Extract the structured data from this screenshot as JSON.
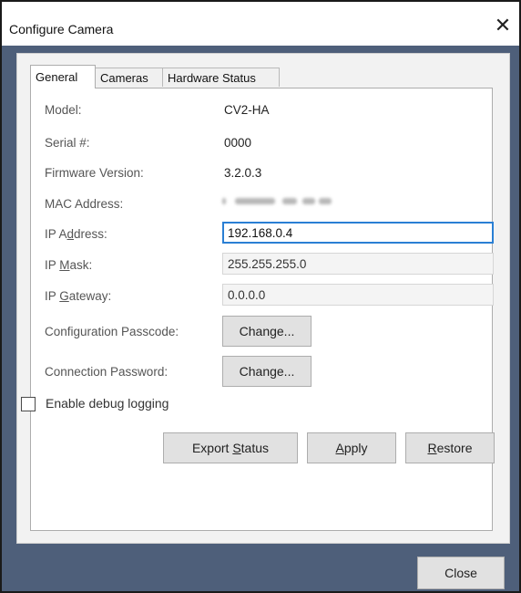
{
  "window": {
    "title": "Configure Camera",
    "close_glyph": "✕"
  },
  "tabs": [
    {
      "label": "General",
      "active": true
    },
    {
      "label": "Cameras",
      "active": false
    },
    {
      "label": "Hardware Status",
      "active": false
    }
  ],
  "general": {
    "model": {
      "label": "Model:",
      "value": "CV2-HA"
    },
    "serial": {
      "label": "Serial #:",
      "value": "0000"
    },
    "firmware": {
      "label": "Firmware Version:",
      "value": "3.2.0.3"
    },
    "mac": {
      "label": "MAC Address:",
      "value_blurred": true
    },
    "ip_address": {
      "label_pre": "IP A",
      "label_ul": "d",
      "label_post": "dress:",
      "value": "192.168.0.4"
    },
    "ip_mask": {
      "label_pre": "IP ",
      "label_ul": "M",
      "label_post": "ask:",
      "value": "255.255.255.0"
    },
    "ip_gateway": {
      "label_pre": "IP ",
      "label_ul": "G",
      "label_post": "ateway:",
      "value": "0.0.0.0"
    },
    "config_passcode": {
      "label": "Configuration Passcode:",
      "button": "Change..."
    },
    "connection_password": {
      "label": "Connection Password:",
      "button": "Change..."
    },
    "debug_logging": {
      "label": "Enable debug logging",
      "checked": false
    }
  },
  "actions": {
    "export_pre": "Export ",
    "export_ul": "S",
    "export_post": "tatus",
    "apply_pre": "",
    "apply_ul": "A",
    "apply_post": "pply",
    "restore_pre": "",
    "restore_ul": "R",
    "restore_post": "estore"
  },
  "footer": {
    "close_label": "Close"
  }
}
